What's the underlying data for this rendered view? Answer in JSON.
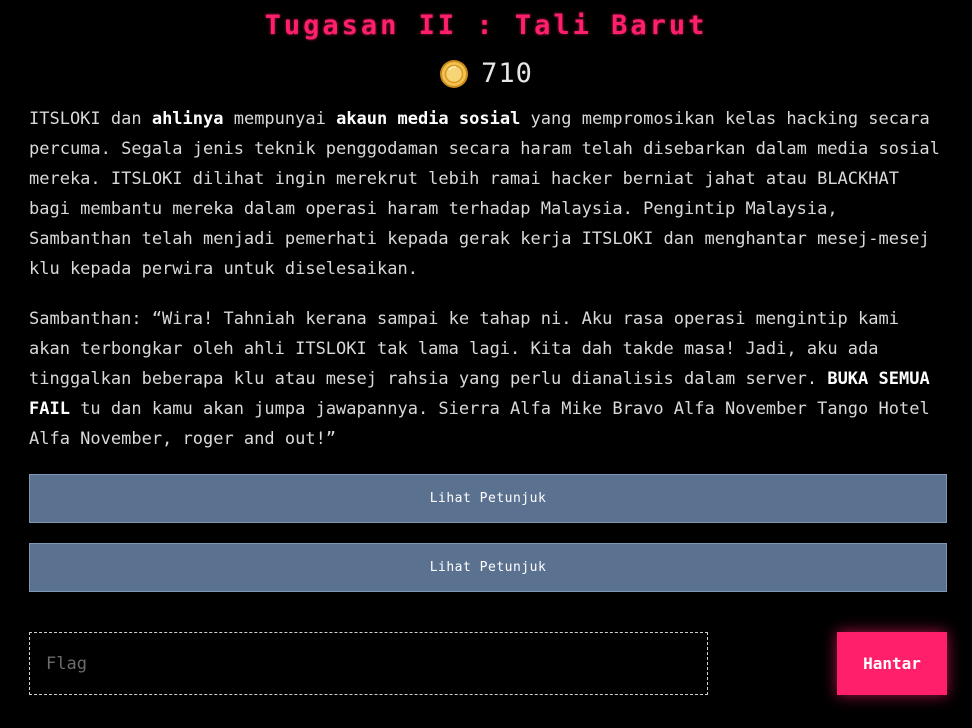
{
  "header": {
    "title": "Tugasan II : Tali Barut",
    "coins": "710",
    "coin_icon": "coin-icon"
  },
  "story": {
    "p1": {
      "t1": "ITSLOKI dan ",
      "b1": "ahlinya",
      "t2": " mempunyai ",
      "b2": "akaun media sosial",
      "t3": " yang mempromosikan kelas hacking secara percuma. Segala jenis teknik penggodaman secara haram telah disebarkan dalam media sosial mereka. ITSLOKI dilihat ingin merekrut lebih ramai hacker berniat jahat atau BLACKHAT bagi membantu mereka dalam operasi haram terhadap Malaysia. Pengintip Malaysia, Sambanthan telah menjadi pemerhati kepada gerak kerja ITSLOKI dan menghantar mesej-mesej klu kepada perwira untuk diselesaikan."
    },
    "p2": {
      "t1": "Sambanthan: “Wira! Tahniah kerana sampai ke tahap ni. Aku rasa operasi mengintip kami akan terbongkar oleh ahli ITSLOKI tak lama lagi. Kita dah takde masa! Jadi, aku ada tinggalkan beberapa klu atau mesej rahsia yang perlu dianalisis dalam server. ",
      "b1": "BUKA SEMUA FAIL",
      "t2": " tu dan kamu akan jumpa jawapannya. Sierra Alfa Mike Bravo Alfa November Tango Hotel Alfa November, roger and out!”"
    }
  },
  "hints": [
    {
      "label": "Lihat Petunjuk"
    },
    {
      "label": "Lihat Petunjuk"
    }
  ],
  "form": {
    "flag_placeholder": "Flag",
    "flag_value": "",
    "submit_label": "Hantar"
  },
  "colors": {
    "accent": "#ff1f6a",
    "hint_button": "#5a7190",
    "background": "#000000",
    "coin": "#f2c14e"
  }
}
